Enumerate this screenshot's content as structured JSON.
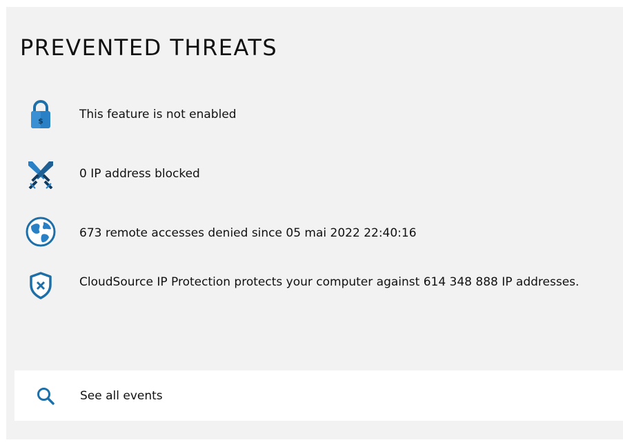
{
  "header": {
    "title": "PREVENTED THREATS"
  },
  "threats": {
    "items": [
      {
        "icon": "lock-icon",
        "text": "This feature is not enabled"
      },
      {
        "icon": "crossed-swords-icon",
        "text": "0 IP address blocked"
      },
      {
        "icon": "globe-icon",
        "text": "673 remote accesses denied since 05 mai 2022 22:40:16"
      },
      {
        "icon": "shield-x-icon",
        "text": "CloudSource IP Protection protects your computer against 614 348 888 IP addresses."
      }
    ]
  },
  "footer": {
    "see_all_label": "See all events",
    "icon": "search-icon"
  },
  "colors": {
    "accent": "#1e6fa8",
    "panel_bg": "#f2f2f2",
    "text": "#111111"
  }
}
